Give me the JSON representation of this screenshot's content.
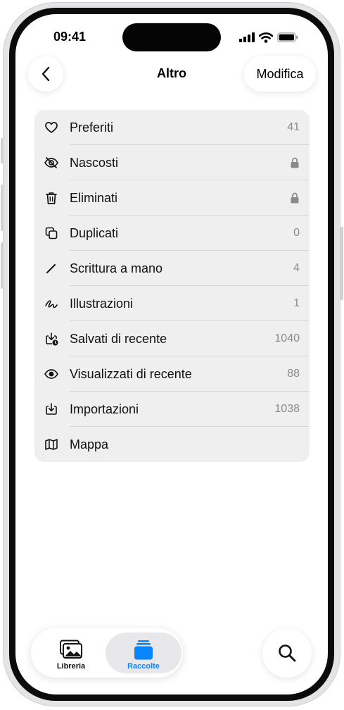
{
  "status": {
    "time": "09:41"
  },
  "nav": {
    "title": "Altro",
    "edit_label": "Modifica",
    "back_icon": "chevron-left-icon"
  },
  "list": {
    "items": [
      {
        "label": "Preferiti",
        "value": "41",
        "icon": "heart-icon"
      },
      {
        "label": "Nascosti",
        "value": "",
        "icon": "eye-slash-icon",
        "locked": true
      },
      {
        "label": "Eliminati",
        "value": "",
        "icon": "trash-icon",
        "locked": true
      },
      {
        "label": "Duplicati",
        "value": "0",
        "icon": "duplicate-icon"
      },
      {
        "label": "Scrittura a mano",
        "value": "4",
        "icon": "pencil-icon"
      },
      {
        "label": "Illustrazioni",
        "value": "1",
        "icon": "scribble-icon"
      },
      {
        "label": "Salvati di recente",
        "value": "1040",
        "icon": "tray-download-badge-icon"
      },
      {
        "label": "Visualizzati di recente",
        "value": "88",
        "icon": "eye-icon"
      },
      {
        "label": "Importazioni",
        "value": "1038",
        "icon": "tray-download-icon"
      },
      {
        "label": "Mappa",
        "value": "",
        "icon": "map-icon"
      }
    ]
  },
  "tabbar": {
    "tabs": [
      {
        "label": "Libreria",
        "icon": "photo-library-icon",
        "selected": false
      },
      {
        "label": "Raccolte",
        "icon": "collections-icon",
        "selected": true
      }
    ]
  },
  "search": {
    "icon": "search-icon"
  },
  "colors": {
    "accent": "#0a84ff",
    "list_bg": "#efeff0",
    "secondary_text": "#8a8a8e"
  }
}
